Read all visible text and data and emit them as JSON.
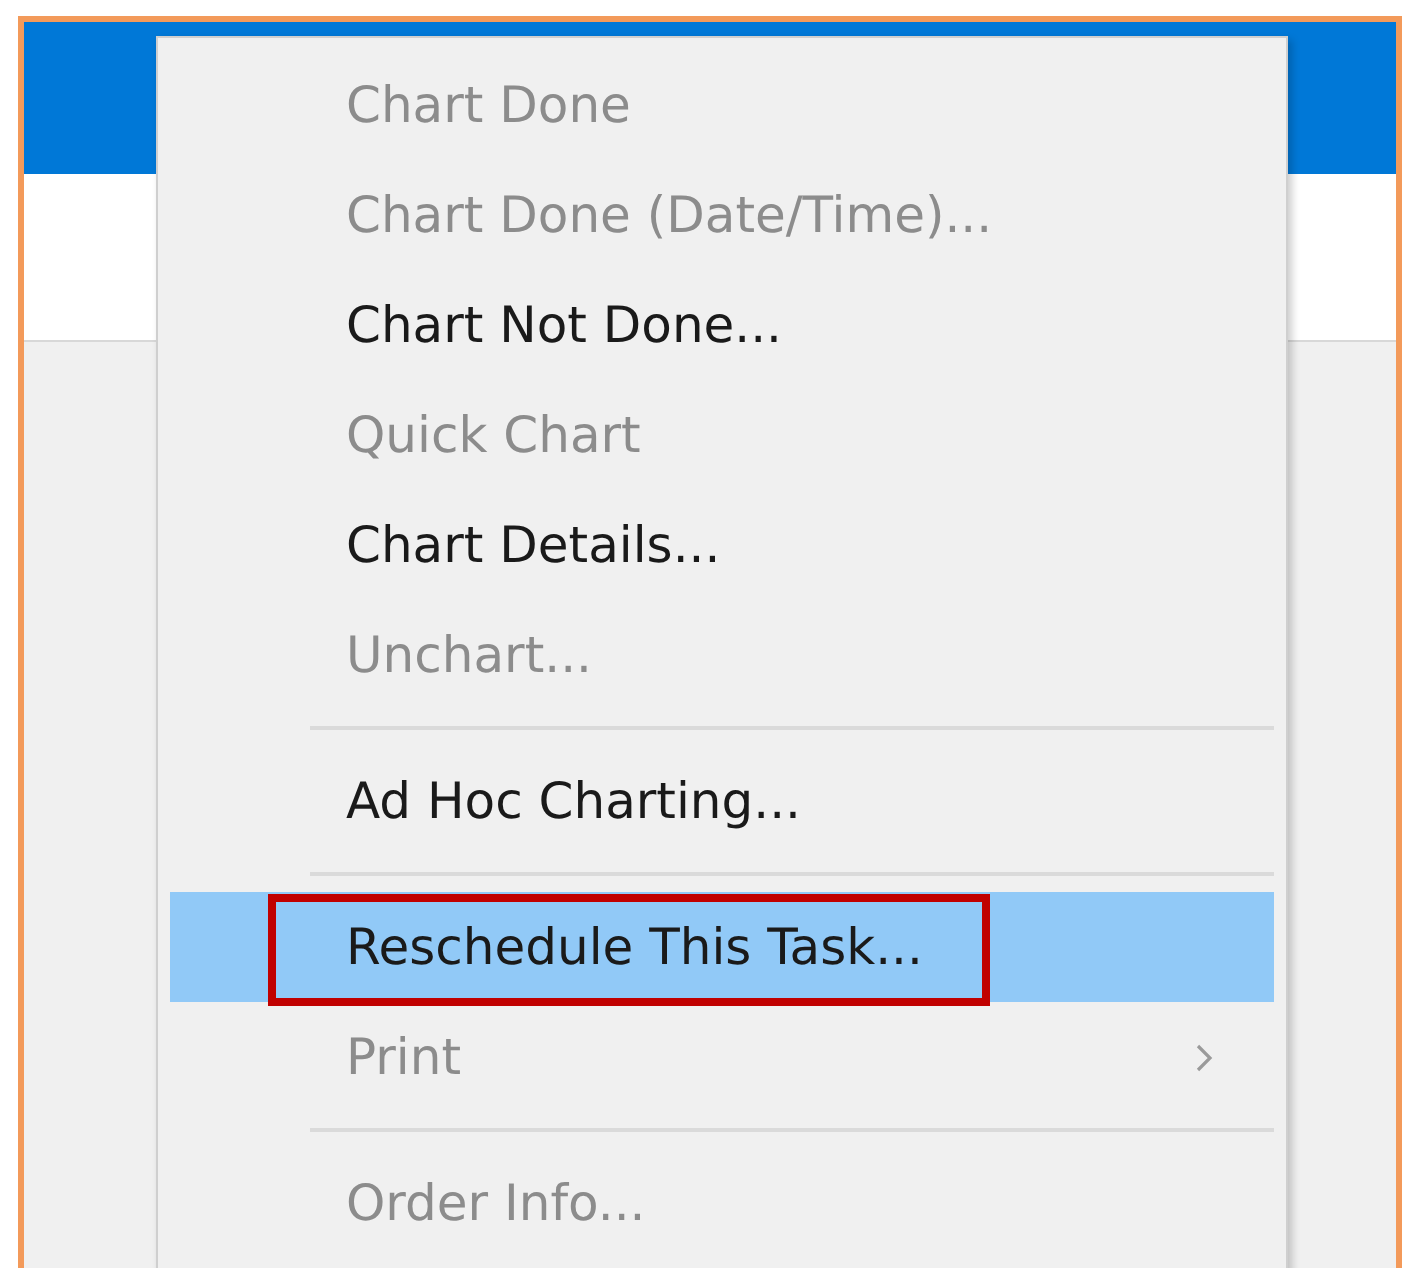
{
  "context_menu": {
    "items": [
      {
        "kind": "item",
        "label": "Chart Done",
        "disabled": true,
        "selected": false
      },
      {
        "kind": "item",
        "label": "Chart Done (Date/Time)...",
        "disabled": true,
        "selected": false
      },
      {
        "kind": "item",
        "label": "Chart Not Done...",
        "disabled": false,
        "selected": false
      },
      {
        "kind": "item",
        "label": "Quick Chart",
        "disabled": true,
        "selected": false
      },
      {
        "kind": "item",
        "label": "Chart Details...",
        "disabled": false,
        "selected": false
      },
      {
        "kind": "item",
        "label": "Unchart...",
        "disabled": true,
        "selected": false
      },
      {
        "kind": "separator"
      },
      {
        "kind": "item",
        "label": "Ad Hoc Charting...",
        "disabled": false,
        "selected": false
      },
      {
        "kind": "separator"
      },
      {
        "kind": "item",
        "label": "Reschedule This Task...",
        "disabled": false,
        "selected": true,
        "outlined": true
      },
      {
        "kind": "item",
        "label": "Print",
        "disabled": true,
        "selected": false,
        "submenu": true
      },
      {
        "kind": "separator"
      },
      {
        "kind": "item",
        "label": "Order Info...",
        "disabled": true,
        "selected": false
      }
    ]
  }
}
